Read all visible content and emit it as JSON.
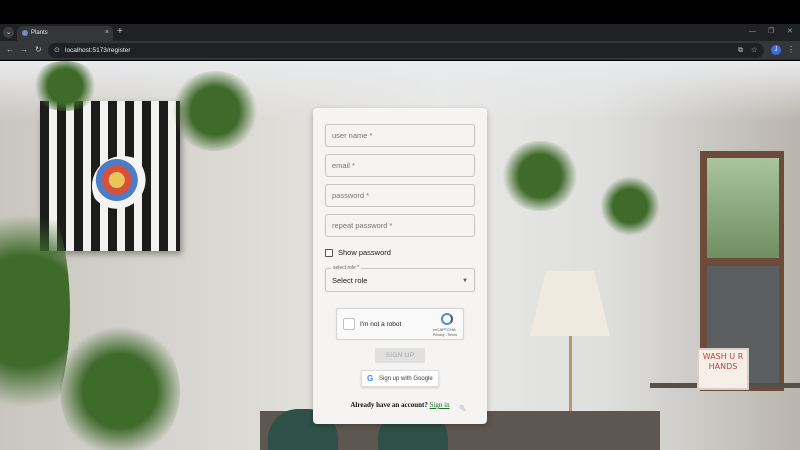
{
  "browser": {
    "tab_title": "Plants",
    "tab_close": "×",
    "new_tab": "+",
    "url": "localhost:5173/register",
    "icons": [
      "tab-search-icon",
      "back-icon",
      "forward-icon",
      "reload-icon",
      "site-info-icon",
      "translate-icon",
      "bookmark-star-icon",
      "profile-icon",
      "menu-icon",
      "minimize-icon",
      "restore-icon",
      "close-window-icon"
    ],
    "profile_initial": "J"
  },
  "form": {
    "username_placeholder": "user name *",
    "email_placeholder": "email *",
    "password_placeholder": "password *",
    "repeat_password_placeholder": "repeat password *",
    "show_password_label": "Show password",
    "role_legend": "select role *",
    "role_value": "Select role",
    "recaptcha_label": "I'm not a robot",
    "recaptcha_brand": "reCAPTCHA",
    "recaptcha_links": "Privacy - Terms",
    "signup_label": "SIGN UP",
    "google_label": "Sign up with Google",
    "account_question": "Already have an account?",
    "signin_link": "Sign in"
  },
  "background": {
    "sign_text": "WASH U R HANDS"
  },
  "colors": {
    "link": "#1a6d2d",
    "google_blue": "#4285f4",
    "card": "#f5f4f2"
  }
}
